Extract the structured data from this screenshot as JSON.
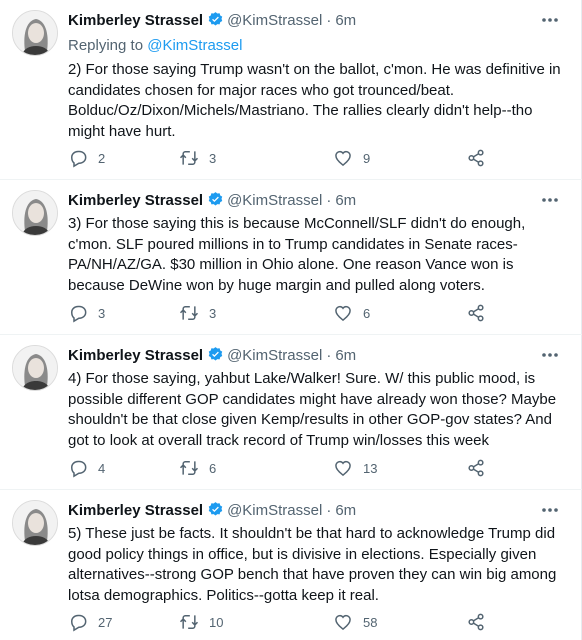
{
  "tweets": [
    {
      "name": "Kimberley Strassel",
      "handle": "@KimStrassel",
      "sep": "·",
      "time": "6m",
      "replying_prefix": "Replying to ",
      "replying_handle": "@KimStrassel",
      "text": "2) For those saying Trump wasn't on the ballot, c'mon. He was definitive in\ncandidates chosen for major races who got trounced/beat.\nBolduc/Oz/Dixon/Michels/Mastriano. The rallies clearly didn't help--tho\nmight have hurt.",
      "replies": "2",
      "retweets": "3",
      "likes": "9"
    },
    {
      "name": "Kimberley Strassel",
      "handle": "@KimStrassel",
      "sep": "·",
      "time": "6m",
      "text": "3) For those saying this is because McConnell/SLF didn't do enough,\nc'mon. SLF poured millions in to Trump candidates in Senate races-\nPA/NH/AZ/GA. $30 million in Ohio alone. One reason Vance won is\nbecause DeWine won by huge margin and pulled along voters.",
      "replies": "3",
      "retweets": "3",
      "likes": "6"
    },
    {
      "name": "Kimberley Strassel",
      "handle": "@KimStrassel",
      "sep": "·",
      "time": "6m",
      "text": "4) For those saying, yahbut Lake/Walker! Sure. W/ this public mood, is\npossible different GOP candidates might have already won those? Maybe\nshouldn't be that close given Kemp/results in other GOP-gov states? And\ngot to look at overall track record of Trump win/losses this week",
      "replies": "4",
      "retweets": "6",
      "likes": "13"
    },
    {
      "name": "Kimberley Strassel",
      "handle": "@KimStrassel",
      "sep": "·",
      "time": "6m",
      "text": "5) These just be facts. It shouldn't be that hard to acknowledge Trump did\ngood policy things in office, but is divisive in elections. Especially given\nalternatives--strong GOP bench that have proven they can win big among\nlotsa demographics. Politics--gotta keep it real.",
      "replies": "27",
      "retweets": "10",
      "likes": "58"
    }
  ],
  "colors": {
    "verified": "#1d9bf0",
    "muted": "#536471",
    "text": "#0f1419",
    "link": "#1d9bf0"
  },
  "icons": [
    "avatar-portrait",
    "verified-badge-icon",
    "more-icon",
    "reply-icon",
    "retweet-icon",
    "like-icon",
    "share-icon"
  ]
}
